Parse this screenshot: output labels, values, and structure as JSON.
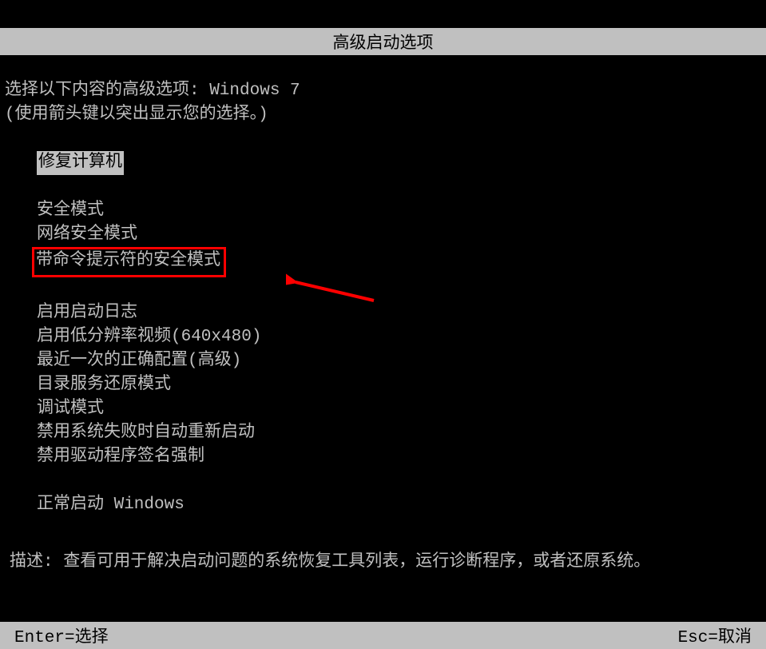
{
  "titlebar": {
    "title": "高级启动选项"
  },
  "instructions": {
    "line1": "选择以下内容的高级选项: Windows 7",
    "line2": "(使用箭头键以突出显示您的选择。)"
  },
  "options": {
    "repair": "修复计算机",
    "safe_mode": "安全模式",
    "safe_mode_network": "网络安全模式",
    "safe_mode_cmd": "带命令提示符的安全模式",
    "enable_boot_log": "启用启动日志",
    "low_res_video": "启用低分辨率视频(640x480)",
    "last_known_good": "最近一次的正确配置(高级)",
    "directory_restore": "目录服务还原模式",
    "debug_mode": "调试模式",
    "disable_auto_restart": "禁用系统失败时自动重新启动",
    "disable_driver_sig": "禁用驱动程序签名强制",
    "start_normally": "正常启动 Windows"
  },
  "description": {
    "label": "描述:",
    "text": "查看可用于解决启动问题的系统恢复工具列表，运行诊断程序，或者还原系统。"
  },
  "footer": {
    "enter": "Enter=选择",
    "esc": "Esc=取消"
  }
}
